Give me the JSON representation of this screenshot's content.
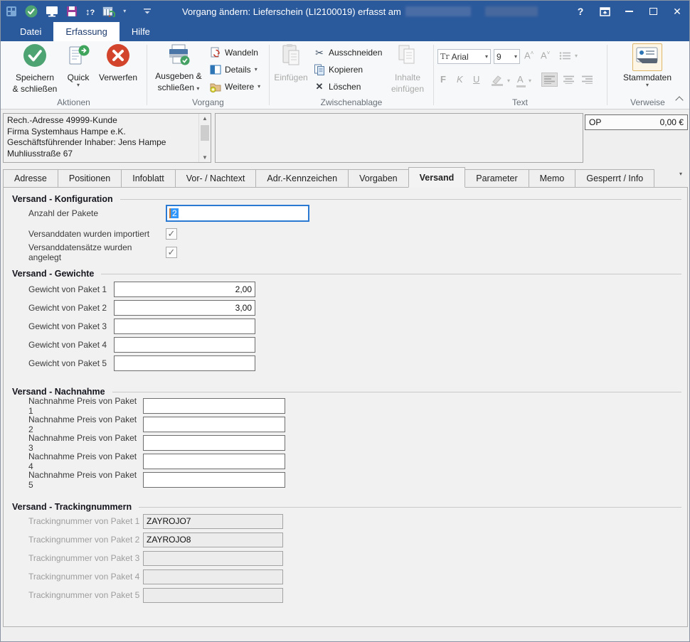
{
  "titlebar": {
    "title": "Vorgang ändern: Lieferschein (LI2100019) erfasst am",
    "help_glyph": "?"
  },
  "menu": {
    "tabs": [
      {
        "label": "Datei",
        "active": false
      },
      {
        "label": "Erfassung",
        "active": true
      },
      {
        "label": "Hilfe",
        "active": false
      }
    ]
  },
  "ribbon": {
    "aktionen": {
      "caption": "Aktionen",
      "save_close_line1": "Speichern",
      "save_close_line2": "& schließen",
      "quick": "Quick",
      "verwerfen": "Verwerfen"
    },
    "vorgang": {
      "caption": "Vorgang",
      "ausgeben_line1": "Ausgeben &",
      "ausgeben_line2": "schließen",
      "wandeln": "Wandeln",
      "details": "Details",
      "weitere": "Weitere"
    },
    "zwischenablage": {
      "caption": "Zwischenablage",
      "einfuegen": "Einfügen",
      "ausschneiden": "Ausschneiden",
      "kopieren": "Kopieren",
      "loeschen": "Löschen",
      "inhalte_line1": "Inhalte",
      "inhalte_line2": "einfügen"
    },
    "text": {
      "caption": "Text",
      "font_name": "Arial",
      "font_prefix": "Tr",
      "font_size": "9",
      "bold": "F",
      "italic": "K",
      "underline": "U",
      "grow": "A",
      "shrink": "A",
      "color_a": "A"
    },
    "verweise": {
      "caption": "Verweise",
      "stammdaten": "Stammdaten"
    }
  },
  "header": {
    "address_lines": [
      "Rech.-Adresse 49999-Kunde",
      "Firma Systemhaus Hampe e.K.",
      "Geschäftsführender Inhaber: Jens Hampe",
      "Muhliusstraße 67"
    ],
    "op_label": "OP",
    "op_value": "0,00 €"
  },
  "tabs": [
    {
      "label": "Adresse",
      "active": false
    },
    {
      "label": "Positionen",
      "active": false
    },
    {
      "label": "Infoblatt",
      "active": false
    },
    {
      "label": "Vor- / Nachtext",
      "active": false
    },
    {
      "label": "Adr.-Kennzeichen",
      "active": false
    },
    {
      "label": "Vorgaben",
      "active": false
    },
    {
      "label": "Versand",
      "active": true
    },
    {
      "label": "Parameter",
      "active": false
    },
    {
      "label": "Memo",
      "active": false
    },
    {
      "label": "Gesperrt / Info",
      "active": false
    }
  ],
  "versand": {
    "konfiguration": {
      "title": "Versand - Konfiguration",
      "anzahl_label": "Anzahl der Pakete",
      "anzahl_value": "2",
      "importiert_label": "Versanddaten wurden importiert",
      "importiert_checked": true,
      "angelegt_label": "Versanddatensätze wurden angelegt",
      "angelegt_checked": true
    },
    "gewichte": {
      "title": "Versand - Gewichte",
      "rows": [
        {
          "label": "Gewicht von Paket 1",
          "value": "2,00"
        },
        {
          "label": "Gewicht von Paket 2",
          "value": "3,00"
        },
        {
          "label": "Gewicht von Paket 3",
          "value": ""
        },
        {
          "label": "Gewicht von Paket 4",
          "value": ""
        },
        {
          "label": "Gewicht von Paket 5",
          "value": ""
        }
      ]
    },
    "nachnahme": {
      "title": "Versand - Nachnahme",
      "rows": [
        {
          "label": "Nachnahme Preis von Paket 1",
          "value": ""
        },
        {
          "label": "Nachnahme Preis von Paket 2",
          "value": ""
        },
        {
          "label": "Nachnahme Preis von Paket 3",
          "value": ""
        },
        {
          "label": "Nachnahme Preis von Paket 4",
          "value": ""
        },
        {
          "label": "Nachnahme Preis von Paket 5",
          "value": ""
        }
      ]
    },
    "tracking": {
      "title": "Versand - Trackingnummern",
      "rows": [
        {
          "label": "Trackingnummer von Paket 1",
          "value": "ZAYROJO7"
        },
        {
          "label": "Trackingnummer von Paket 2",
          "value": "ZAYROJO8"
        },
        {
          "label": "Trackingnummer von Paket 3",
          "value": ""
        },
        {
          "label": "Trackingnummer von Paket 4",
          "value": ""
        },
        {
          "label": "Trackingnummer von Paket 5",
          "value": ""
        }
      ]
    }
  },
  "icons": {
    "checkmark": "✓",
    "dropdown": "▾",
    "scissors": "✂",
    "close_x": "✕",
    "updown": "↕",
    "qmark": "?",
    "up_arrow": "▲",
    "down_arrow": "▼"
  },
  "colors": {
    "titlebar": "#2b5a9c",
    "green": "#4ea373",
    "red": "#d2452c",
    "focus_border": "#2a7ad4",
    "selection": "#3297fd"
  }
}
